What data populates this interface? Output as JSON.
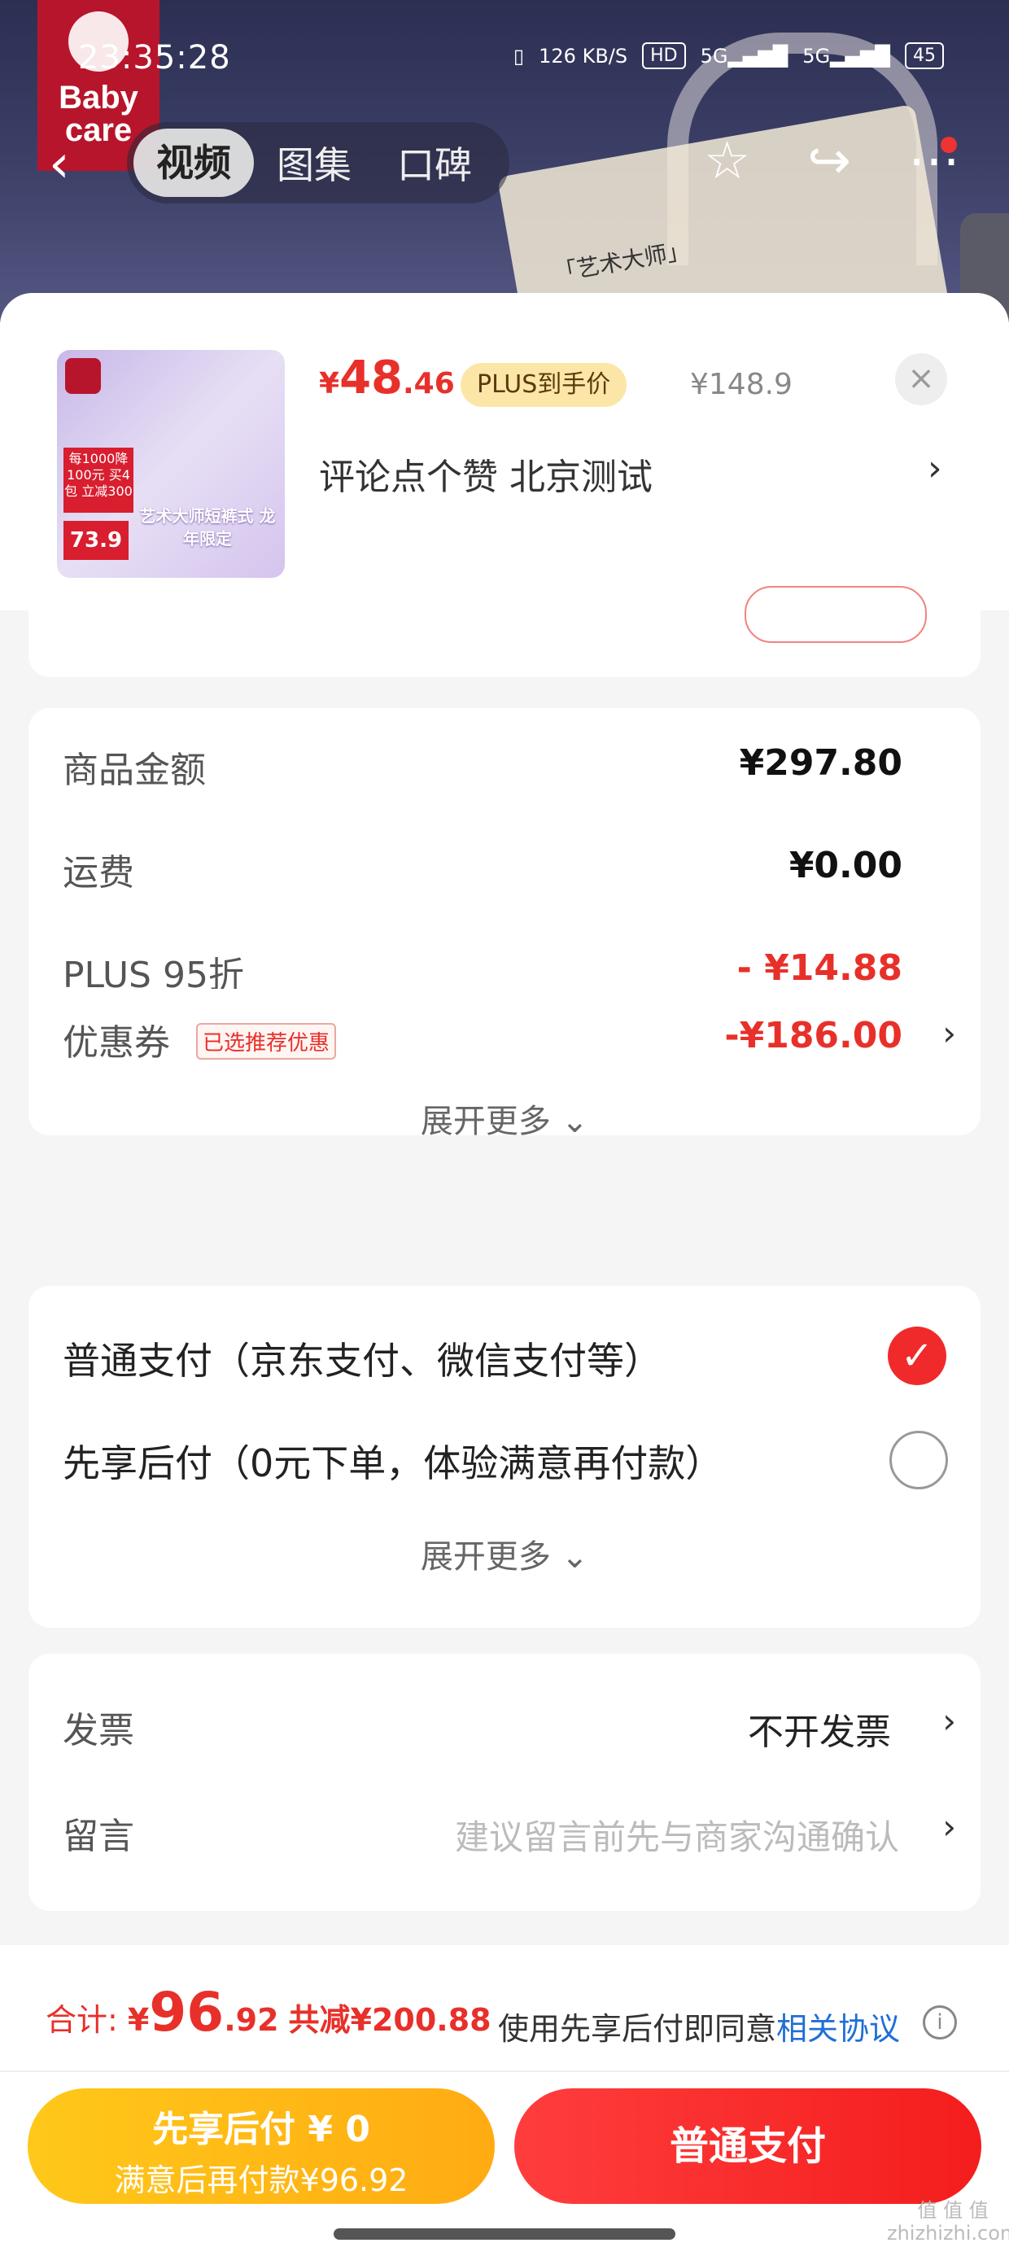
{
  "status_bar": {
    "time": "23:35:28",
    "net_speed": "126 KB/S",
    "hd": "HD",
    "sig1": "5G",
    "sig2": "5G",
    "battery": "45"
  },
  "top": {
    "brand": "Baby care",
    "tabs": [
      "视频",
      "图集",
      "口碑"
    ],
    "bag_text": "「艺术大师」"
  },
  "product": {
    "price_symbol": "¥",
    "price_int": "48",
    "price_dec": ".46",
    "plus_tag": "PLUS到手价",
    "original_price": "¥148.9",
    "name": "评论点个赞  北京测试",
    "thumb": {
      "badge": "每1000降100元 买4包 立减300",
      "price": "73.9",
      "caption": "艺术大师短裤式 龙年限定"
    }
  },
  "summary": {
    "rows": [
      {
        "label": "商品金额",
        "value": "¥297.80"
      },
      {
        "label": "运费",
        "value": "¥0.00"
      },
      {
        "label": "PLUS 95折",
        "value": "- ¥14.88"
      },
      {
        "label": "优惠券",
        "tag": "已选推荐优惠",
        "value": "-¥186.00"
      }
    ],
    "expand": "展开更多 ⌄"
  },
  "payment": {
    "options": [
      {
        "label": "普通支付（京东支付、微信支付等）",
        "selected": true
      },
      {
        "label": "先享后付（0元下单，体验满意再付款）",
        "selected": false
      }
    ],
    "expand": "展开更多 ⌄"
  },
  "extra": {
    "invoice_label": "发票",
    "invoice_value": "不开发票",
    "note_label": "留言",
    "note_placeholder": "建议留言前先与商家沟通确认"
  },
  "bottom": {
    "total_label": "合计: ",
    "total_symbol": "¥",
    "total_int": "96",
    "total_dec": ".92",
    "saved": "共减¥200.88",
    "agree_text": "使用先享后付即同意",
    "agree_link": "相关协议",
    "btn_later_line1": "先享后付 ¥ 0",
    "btn_later_line2": "满意后再付款¥96.92",
    "btn_pay": "普通支付",
    "watermark": "值 值 值 zhizhizhi.com"
  },
  "colors": {
    "accent_red": "#e8302a",
    "link_blue": "#1f6fd6",
    "later_yellow": "#ffb814"
  }
}
